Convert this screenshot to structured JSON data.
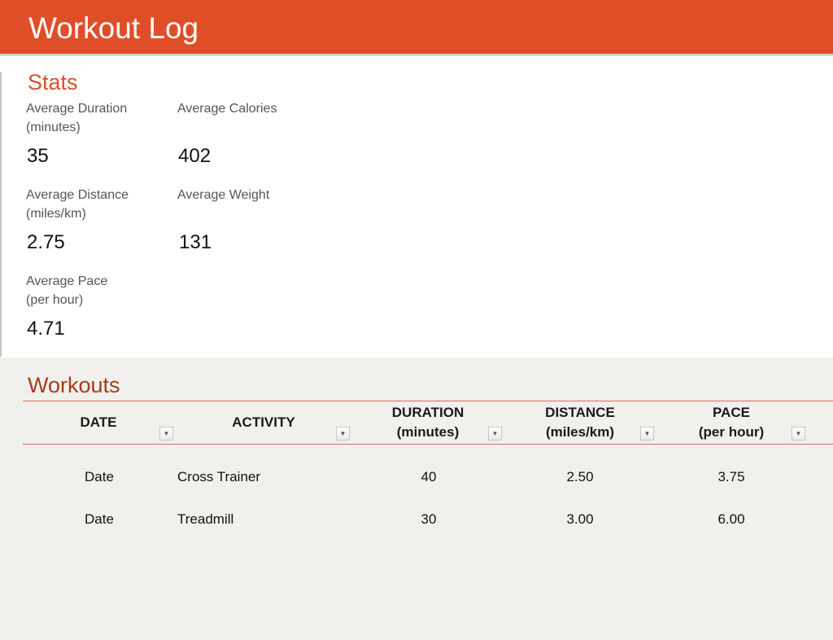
{
  "header": {
    "title": "Workout Log"
  },
  "stats": {
    "title": "Stats",
    "items": [
      {
        "label": "Average Duration\n(minutes)",
        "value": "35"
      },
      {
        "label": "Average Calories",
        "value": "402"
      },
      {
        "label": "Average Distance\n(miles/km)",
        "value": "2.75"
      },
      {
        "label": "Average Weight",
        "value": "131"
      },
      {
        "label": "Average Pace\n(per hour)",
        "value": "4.71"
      }
    ]
  },
  "workouts": {
    "title": "Workouts",
    "columns": [
      "DATE",
      "ACTIVITY",
      "DURATION\n(minutes)",
      "DISTANCE\n(miles/km)",
      "PACE\n(per hour)"
    ],
    "rows": [
      [
        "Date",
        "Cross Trainer",
        "40",
        "2.50",
        "3.75"
      ],
      [
        "Date",
        "Treadmill",
        "30",
        "3.00",
        "6.00"
      ]
    ],
    "filter_icon": "dropdown-arrow"
  },
  "colors": {
    "header": "#e04e28",
    "accent_text": "#e04e28",
    "section_title": "#a33d1c",
    "background": "#f2f0ec",
    "panel": "#ffffff",
    "rule": "#c9765b"
  }
}
